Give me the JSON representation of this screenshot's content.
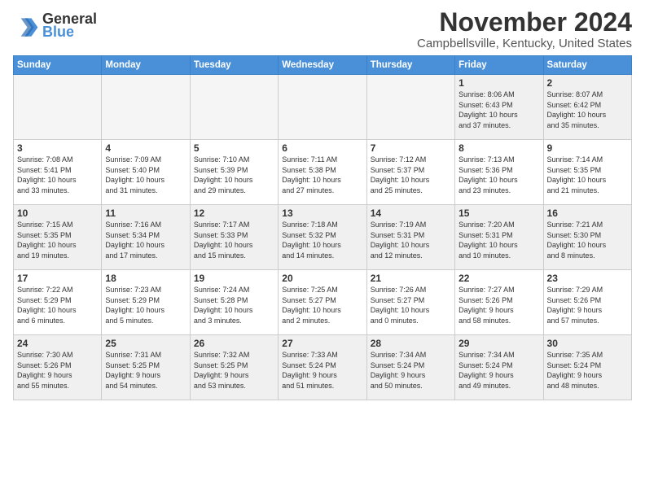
{
  "header": {
    "logo_line1": "General",
    "logo_line2": "Blue",
    "month": "November 2024",
    "location": "Campbellsville, Kentucky, United States"
  },
  "days_of_week": [
    "Sunday",
    "Monday",
    "Tuesday",
    "Wednesday",
    "Thursday",
    "Friday",
    "Saturday"
  ],
  "weeks": [
    [
      {
        "day": "",
        "info": "",
        "empty": true
      },
      {
        "day": "",
        "info": "",
        "empty": true
      },
      {
        "day": "",
        "info": "",
        "empty": true
      },
      {
        "day": "",
        "info": "",
        "empty": true
      },
      {
        "day": "",
        "info": "",
        "empty": true
      },
      {
        "day": "1",
        "info": "Sunrise: 8:06 AM\nSunset: 6:43 PM\nDaylight: 10 hours\nand 37 minutes."
      },
      {
        "day": "2",
        "info": "Sunrise: 8:07 AM\nSunset: 6:42 PM\nDaylight: 10 hours\nand 35 minutes."
      }
    ],
    [
      {
        "day": "3",
        "info": "Sunrise: 7:08 AM\nSunset: 5:41 PM\nDaylight: 10 hours\nand 33 minutes."
      },
      {
        "day": "4",
        "info": "Sunrise: 7:09 AM\nSunset: 5:40 PM\nDaylight: 10 hours\nand 31 minutes."
      },
      {
        "day": "5",
        "info": "Sunrise: 7:10 AM\nSunset: 5:39 PM\nDaylight: 10 hours\nand 29 minutes."
      },
      {
        "day": "6",
        "info": "Sunrise: 7:11 AM\nSunset: 5:38 PM\nDaylight: 10 hours\nand 27 minutes."
      },
      {
        "day": "7",
        "info": "Sunrise: 7:12 AM\nSunset: 5:37 PM\nDaylight: 10 hours\nand 25 minutes."
      },
      {
        "day": "8",
        "info": "Sunrise: 7:13 AM\nSunset: 5:36 PM\nDaylight: 10 hours\nand 23 minutes."
      },
      {
        "day": "9",
        "info": "Sunrise: 7:14 AM\nSunset: 5:35 PM\nDaylight: 10 hours\nand 21 minutes."
      }
    ],
    [
      {
        "day": "10",
        "info": "Sunrise: 7:15 AM\nSunset: 5:35 PM\nDaylight: 10 hours\nand 19 minutes."
      },
      {
        "day": "11",
        "info": "Sunrise: 7:16 AM\nSunset: 5:34 PM\nDaylight: 10 hours\nand 17 minutes."
      },
      {
        "day": "12",
        "info": "Sunrise: 7:17 AM\nSunset: 5:33 PM\nDaylight: 10 hours\nand 15 minutes."
      },
      {
        "day": "13",
        "info": "Sunrise: 7:18 AM\nSunset: 5:32 PM\nDaylight: 10 hours\nand 14 minutes."
      },
      {
        "day": "14",
        "info": "Sunrise: 7:19 AM\nSunset: 5:31 PM\nDaylight: 10 hours\nand 12 minutes."
      },
      {
        "day": "15",
        "info": "Sunrise: 7:20 AM\nSunset: 5:31 PM\nDaylight: 10 hours\nand 10 minutes."
      },
      {
        "day": "16",
        "info": "Sunrise: 7:21 AM\nSunset: 5:30 PM\nDaylight: 10 hours\nand 8 minutes."
      }
    ],
    [
      {
        "day": "17",
        "info": "Sunrise: 7:22 AM\nSunset: 5:29 PM\nDaylight: 10 hours\nand 6 minutes."
      },
      {
        "day": "18",
        "info": "Sunrise: 7:23 AM\nSunset: 5:29 PM\nDaylight: 10 hours\nand 5 minutes."
      },
      {
        "day": "19",
        "info": "Sunrise: 7:24 AM\nSunset: 5:28 PM\nDaylight: 10 hours\nand 3 minutes."
      },
      {
        "day": "20",
        "info": "Sunrise: 7:25 AM\nSunset: 5:27 PM\nDaylight: 10 hours\nand 2 minutes."
      },
      {
        "day": "21",
        "info": "Sunrise: 7:26 AM\nSunset: 5:27 PM\nDaylight: 10 hours\nand 0 minutes."
      },
      {
        "day": "22",
        "info": "Sunrise: 7:27 AM\nSunset: 5:26 PM\nDaylight: 9 hours\nand 58 minutes."
      },
      {
        "day": "23",
        "info": "Sunrise: 7:29 AM\nSunset: 5:26 PM\nDaylight: 9 hours\nand 57 minutes."
      }
    ],
    [
      {
        "day": "24",
        "info": "Sunrise: 7:30 AM\nSunset: 5:26 PM\nDaylight: 9 hours\nand 55 minutes."
      },
      {
        "day": "25",
        "info": "Sunrise: 7:31 AM\nSunset: 5:25 PM\nDaylight: 9 hours\nand 54 minutes."
      },
      {
        "day": "26",
        "info": "Sunrise: 7:32 AM\nSunset: 5:25 PM\nDaylight: 9 hours\nand 53 minutes."
      },
      {
        "day": "27",
        "info": "Sunrise: 7:33 AM\nSunset: 5:24 PM\nDaylight: 9 hours\nand 51 minutes."
      },
      {
        "day": "28",
        "info": "Sunrise: 7:34 AM\nSunset: 5:24 PM\nDaylight: 9 hours\nand 50 minutes."
      },
      {
        "day": "29",
        "info": "Sunrise: 7:34 AM\nSunset: 5:24 PM\nDaylight: 9 hours\nand 49 minutes."
      },
      {
        "day": "30",
        "info": "Sunrise: 7:35 AM\nSunset: 5:24 PM\nDaylight: 9 hours\nand 48 minutes."
      }
    ]
  ]
}
